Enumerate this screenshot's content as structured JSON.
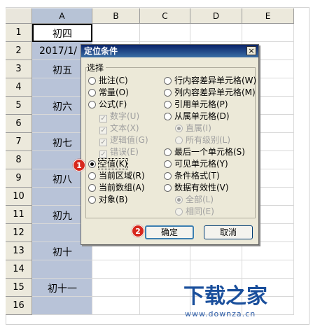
{
  "columns": [
    "A",
    "B",
    "C",
    "D",
    "E"
  ],
  "rows": [
    "1",
    "2",
    "3",
    "4",
    "5",
    "6",
    "7",
    "8",
    "9",
    "10",
    "11",
    "12",
    "13",
    "14",
    "15",
    "16"
  ],
  "cells": {
    "a1": "初四",
    "a2": "2017/1/",
    "a3": "初五",
    "a5": "初六",
    "a7": "初七",
    "a9": "初八",
    "a11": "初九",
    "a13": "初十",
    "a15": "初十一"
  },
  "dialog": {
    "title": "定位条件",
    "close": "×",
    "group": "选择",
    "left_options": [
      {
        "label": "批注(C)",
        "state": "normal"
      },
      {
        "label": "常量(O)",
        "state": "normal"
      },
      {
        "label": "公式(F)",
        "state": "normal"
      },
      {
        "label": "数字(U)",
        "state": "sub-disabled"
      },
      {
        "label": "文本(X)",
        "state": "sub-disabled"
      },
      {
        "label": "逻辑值(G)",
        "state": "sub-disabled"
      },
      {
        "label": "错误(E)",
        "state": "sub-disabled"
      },
      {
        "label": "空值(K)",
        "state": "selected"
      },
      {
        "label": "当前区域(R)",
        "state": "normal"
      },
      {
        "label": "当前数组(A)",
        "state": "normal"
      },
      {
        "label": "对象(B)",
        "state": "normal"
      }
    ],
    "right_options": [
      {
        "label": "行内容差异单元格(W)",
        "state": "normal"
      },
      {
        "label": "列内容差异单元格(M)",
        "state": "normal"
      },
      {
        "label": "引用单元格(P)",
        "state": "normal"
      },
      {
        "label": "从属单元格(D)",
        "state": "normal"
      },
      {
        "label": "直属(I)",
        "state": "sub-disabled-checked"
      },
      {
        "label": "所有级别(L)",
        "state": "sub-disabled"
      },
      {
        "label": "最后一个单元格(S)",
        "state": "normal"
      },
      {
        "label": "可见单元格(Y)",
        "state": "normal"
      },
      {
        "label": "条件格式(T)",
        "state": "normal"
      },
      {
        "label": "数据有效性(V)",
        "state": "normal"
      },
      {
        "label": "全部(L)",
        "state": "sub-disabled-checked"
      },
      {
        "label": "相同(E)",
        "state": "sub-disabled"
      }
    ],
    "ok": "确定",
    "cancel": "取消"
  },
  "badges": [
    "1",
    "2"
  ],
  "watermark": {
    "text": "下载之家",
    "url": "www.downza.cn"
  },
  "colors": {
    "selection": "#b8c3d8",
    "title": "#0a246a",
    "badge": "#d7281d",
    "watermark": "#1a4f9c"
  }
}
